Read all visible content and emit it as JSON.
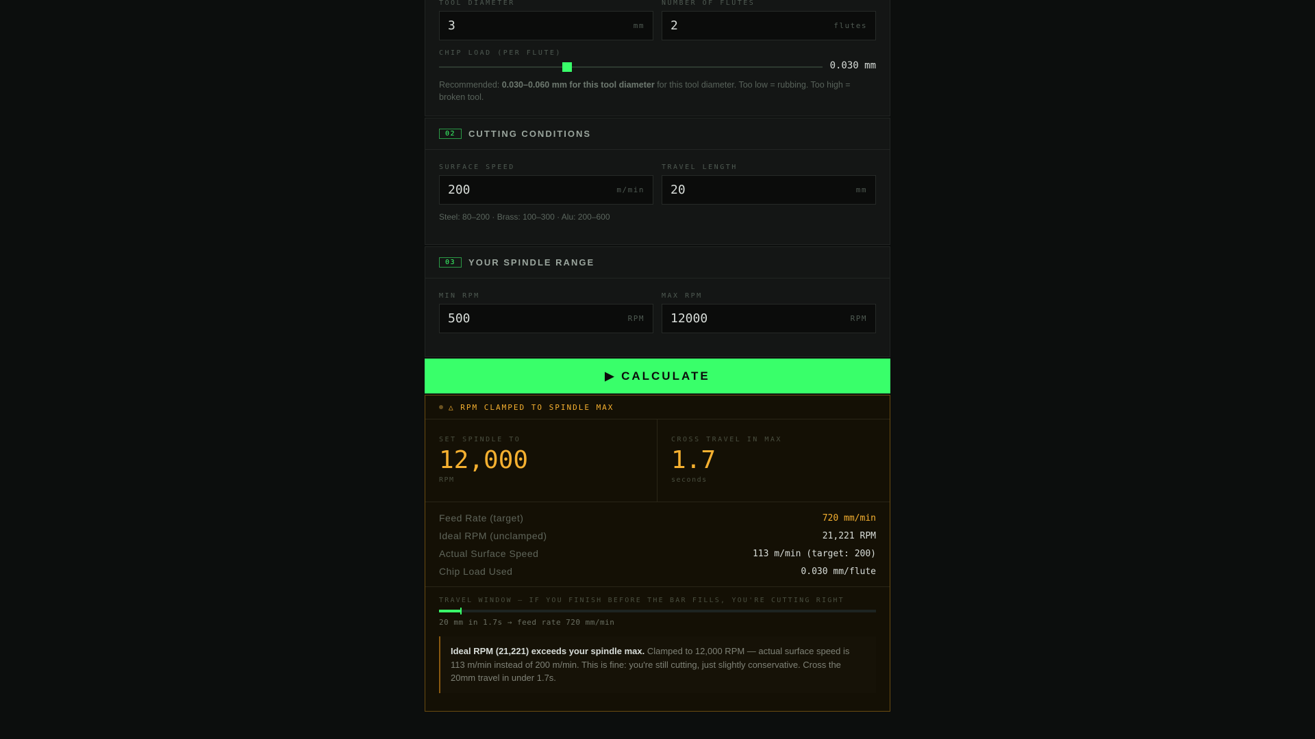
{
  "tool": {
    "diameter_label": "TOOL DIAMETER",
    "diameter_value": "3",
    "diameter_unit": "mm",
    "flutes_label": "NUMBER OF FLUTES",
    "flutes_value": "2",
    "flutes_unit": "flutes",
    "chip_label": "CHIP LOAD (PER FLUTE)",
    "chip_value": "0.030 mm",
    "chip_slider_fraction": 0.33,
    "rec_prefix": "Recommended: ",
    "rec_bold": "0.030–0.060 mm for this tool diameter",
    "rec_suffix": " for this tool diameter. Too low = rubbing. Too high = broken tool."
  },
  "cutting": {
    "num": "02",
    "title": "CUTTING CONDITIONS",
    "speed_label": "SURFACE SPEED",
    "speed_value": "200",
    "speed_unit": "m/min",
    "travel_label": "TRAVEL LENGTH",
    "travel_value": "20",
    "travel_unit": "mm",
    "hint": "Steel: 80–200 · Brass: 100–300 · Alu: 200–600"
  },
  "spindle": {
    "num": "03",
    "title": "YOUR SPINDLE RANGE",
    "min_label": "MIN RPM",
    "min_value": "500",
    "min_unit": "RPM",
    "max_label": "MAX RPM",
    "max_value": "12000",
    "max_unit": "RPM"
  },
  "calculate_label": "▶ CALCULATE",
  "results": {
    "warning": "△ RPM CLAMPED TO SPINDLE MAX",
    "spindle_label": "SET SPINDLE TO",
    "spindle_value": "12,000",
    "spindle_unit": "RPM",
    "cross_label": "CROSS TRAVEL IN MAX",
    "cross_value": "1.7",
    "cross_unit": "seconds",
    "rows": [
      {
        "k": "Feed Rate (target)",
        "v": "720 mm/min"
      },
      {
        "k": "Ideal RPM (unclamped)",
        "v": "21,221 RPM"
      },
      {
        "k": "Actual Surface Speed",
        "v": "113 m/min (target: 200)"
      },
      {
        "k": "Chip Load Used",
        "v": "0.030 mm/flute"
      }
    ],
    "travel_label": "TRAVEL WINDOW — IF YOU FINISH BEFORE THE BAR FILLS, YOU'RE CUTTING RIGHT",
    "travel_fill_fraction": 0.05,
    "travel_caption": "20 mm in 1.7s → feed rate 720 mm/min",
    "note_bold": "Ideal RPM (21,221) exceeds your spindle max.",
    "note_text": " Clamped to 12,000 RPM — actual surface speed is 113 m/min instead of 200 m/min. This is fine: you're still cutting, just slightly conservative. Cross the 20mm travel in under 1.7s."
  },
  "colors": {
    "accent": "#39ff6a",
    "warn": "#f5b030"
  }
}
